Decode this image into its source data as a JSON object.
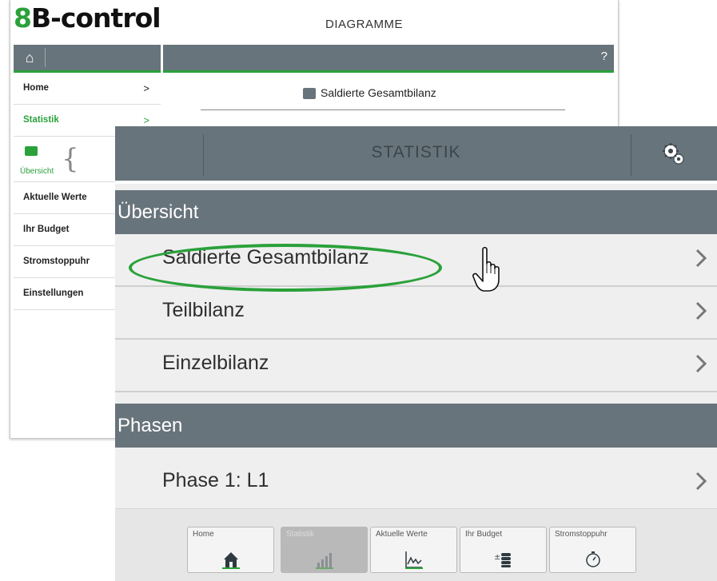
{
  "background_app": {
    "logo_accent": "8",
    "logo_text": "B-control",
    "title": "DIAGRAMME",
    "help_label": "?",
    "menu": [
      {
        "label": "Home",
        "chevron": ">"
      },
      {
        "label": "Statistik",
        "chevron": ">",
        "active": true
      },
      {
        "label": "Übersicht",
        "type": "subitem"
      },
      {
        "label": "Aktuelle Werte"
      },
      {
        "label": "Ihr Budget"
      },
      {
        "label": "Stromstoppuhr"
      },
      {
        "label": "Einstellungen"
      }
    ],
    "content_title": "Saldierte Gesamtbilanz",
    "brace": "{"
  },
  "app": {
    "title": "STATISTIK",
    "settings_icon": "gears-icon",
    "sections": [
      {
        "header": "Übersicht",
        "items": [
          "Saldierte Gesamtbilanz",
          "Teilbilanz",
          "Einzelbilanz"
        ]
      },
      {
        "header": "Phasen",
        "items": [
          "Phase 1: L1"
        ]
      }
    ],
    "highlighted_item": "Saldierte Gesamtbilanz",
    "bottom_tabs": [
      {
        "label": "Home",
        "icon": "house-icon"
      },
      {
        "label": "Statistik",
        "icon": "bar-chart-icon",
        "active": true
      },
      {
        "label": "Aktuelle Werte",
        "icon": "line-chart-icon"
      },
      {
        "label": "Ihr Budget",
        "icon": "coins-icon"
      },
      {
        "label": "Stromstoppuhr",
        "icon": "stopwatch-icon"
      }
    ]
  },
  "colors": {
    "header_gray": "#68747b",
    "accent_green": "#2aa13a",
    "row_bg": "#efefef"
  }
}
